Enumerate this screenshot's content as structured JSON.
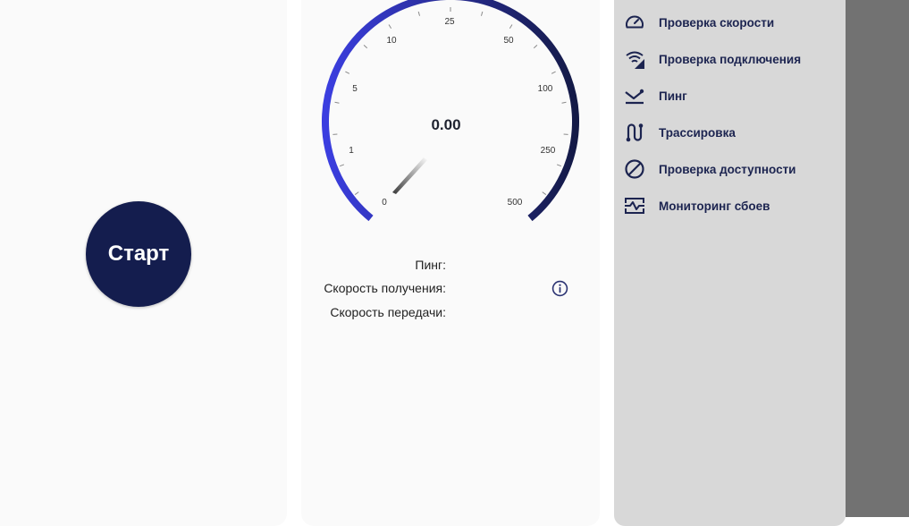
{
  "start": {
    "label": "Старт"
  },
  "gauge": {
    "value": "0.00",
    "scale_labels": [
      "0",
      "1",
      "5",
      "10",
      "25",
      "50",
      "100",
      "250",
      "500"
    ],
    "arc_colors": {
      "start": "#3b3ee0",
      "end": "#141a46"
    }
  },
  "stats": {
    "ping_label": "Пинг:",
    "download_label": "Скорость получения:",
    "upload_label": "Скорость передачи:"
  },
  "menu": {
    "items": [
      {
        "label": "Проверка скорости",
        "icon": "speedometer-icon"
      },
      {
        "label": "Проверка подключения",
        "icon": "network-check-icon"
      },
      {
        "label": "Пинг",
        "icon": "ping-icon"
      },
      {
        "label": "Трассировка",
        "icon": "route-icon"
      },
      {
        "label": "Проверка доступности",
        "icon": "block-icon"
      },
      {
        "label": "Мониторинг сбоев",
        "icon": "monitoring-icon"
      }
    ]
  },
  "colors": {
    "accent": "#141d4e",
    "menu_text": "#1c2450",
    "menu_bg": "#d8d8d8",
    "scrim": "#727272",
    "panel_bg": "#fafafa"
  }
}
